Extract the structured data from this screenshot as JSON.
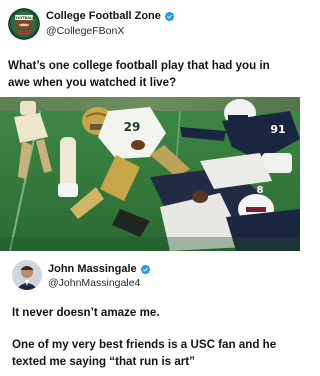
{
  "post": {
    "author_name": "College Football Zone",
    "author_handle": "@CollegeFBonX",
    "avatar_text": "FOOTBALL",
    "text": "What’s one college football play that had you in awe when you watched it live?",
    "media": {
      "jersey_numbers": [
        "29",
        "91",
        "8"
      ]
    }
  },
  "reply": {
    "author_name": "John Massingale",
    "author_handle": "@JohnMassingale4",
    "line1": "It never doesn’t amaze me.",
    "line2": "One of my very best friends is a USC fan and he texted me saying “that run is art”"
  },
  "colors": {
    "verified": "#1d9bf0",
    "text": "#0f1419",
    "grass": "#2f7a3a",
    "navy_jersey": "#1a2540",
    "gold_helmet": "#c9a54a"
  },
  "icons": {
    "verified": "verified-badge-icon"
  }
}
